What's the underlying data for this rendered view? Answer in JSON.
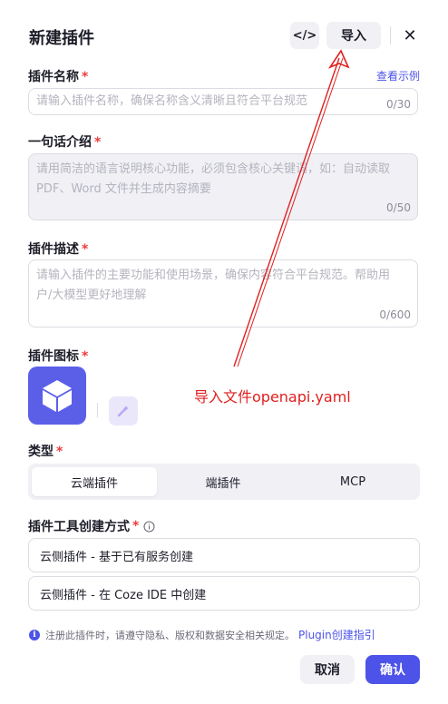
{
  "dialog": {
    "title": "新建插件",
    "code_button": "</>",
    "import_button": "导入",
    "close_glyph": "✕"
  },
  "form": {
    "name": {
      "label": "插件名称",
      "required_mark": "*",
      "example_link": "查看示例",
      "placeholder": "请输入插件名称，确保名称含义清晰且符合平台规范",
      "counter": "0/30"
    },
    "intro": {
      "label": "一句话介绍",
      "required_mark": "*",
      "placeholder": "请用简洁的语言说明核心功能，必须包含核心关键词，如：自动读取 PDF、Word 文件并生成内容摘要",
      "counter": "0/50"
    },
    "description": {
      "label": "插件描述",
      "required_mark": "*",
      "placeholder": "请输入插件的主要功能和使用场景，确保内容符合平台规范。帮助用户/大模型更好地理解",
      "counter": "0/600"
    },
    "icon": {
      "label": "插件图标",
      "required_mark": "*"
    },
    "type": {
      "label": "类型",
      "required_mark": "*",
      "options": [
        "云端插件",
        "端插件",
        "MCP"
      ],
      "selected": "云端插件"
    },
    "creation_method": {
      "label": "插件工具创建方式",
      "required_mark": "*",
      "options": [
        "云侧插件 - 基于已有服务创建",
        "云侧插件 - 在 Coze IDE 中创建"
      ]
    }
  },
  "notice": {
    "text": "注册此插件时，请遵守隐私、版权和数据安全相关规定。",
    "link": "Plugin创建指引"
  },
  "footer": {
    "cancel": "取消",
    "confirm": "确认"
  },
  "annotation": {
    "text": "导入文件openapi.yaml",
    "color": "#e02020"
  },
  "colors": {
    "accent": "#4d53e8",
    "required": "#ef3b3b",
    "icon_tile": "#5b5fe8"
  }
}
